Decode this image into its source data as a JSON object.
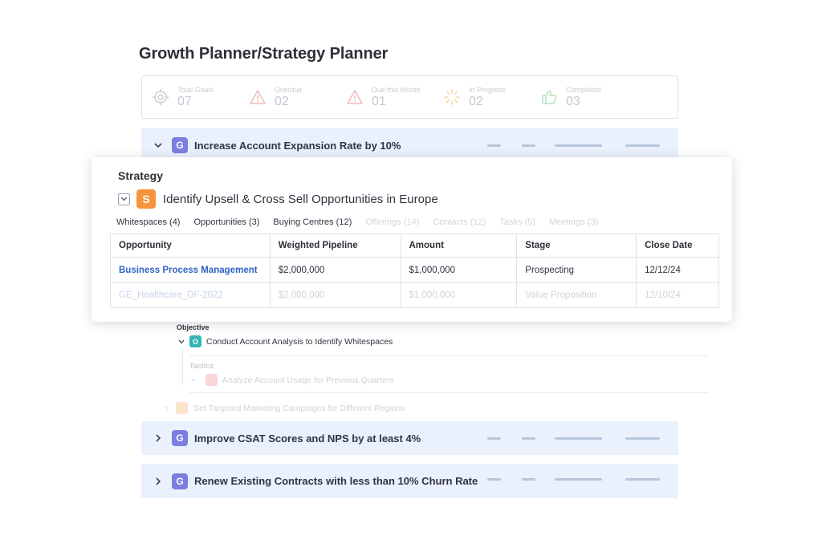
{
  "page": {
    "title": "Growth Planner/Strategy Planner"
  },
  "stats": [
    {
      "label": "Total Goals",
      "value": "07",
      "icon": "target-icon"
    },
    {
      "label": "Overdue",
      "value": "02",
      "icon": "warning-icon"
    },
    {
      "label": "Due this Month",
      "value": "01",
      "icon": "warning-icon"
    },
    {
      "label": "In Progress",
      "value": "02",
      "icon": "spinner-icon"
    },
    {
      "label": "Completed",
      "value": "03",
      "icon": "thumbs-up-icon"
    }
  ],
  "goals": [
    {
      "badge": "G",
      "title": "Increase Account Expansion Rate by 10%",
      "expanded": true
    },
    {
      "badge": "G",
      "title": "Improve CSAT Scores and NPS by at least 4%",
      "expanded": false
    },
    {
      "badge": "G",
      "title": "Renew Existing Contracts with less than 10% Churn Rate",
      "expanded": false
    }
  ],
  "strategy": {
    "heading": "Strategy",
    "badge": "S",
    "title": "Identify Upsell & Cross Sell Opportunities in Europe",
    "tabs": [
      {
        "label": "Whitespaces (4)",
        "active": true
      },
      {
        "label": "Opportunities (3)",
        "active": true
      },
      {
        "label": "Buying Centres (12)",
        "active": true
      },
      {
        "label": "Offerings (14)",
        "active": false
      },
      {
        "label": "Contacts (12)",
        "active": false
      },
      {
        "label": "Tasks (5)",
        "active": false
      },
      {
        "label": "Meetings (3)",
        "active": false
      }
    ],
    "table": {
      "headers": [
        "Opportunity",
        "Weighted Pipeline",
        "Amount",
        "Stage",
        "Close Date"
      ],
      "rows": [
        [
          "Business Process Management",
          "$2,000,000",
          "$1,000,000",
          "Prospecting",
          "12/12/24"
        ],
        [
          "GE_Healthcare_DF-2022",
          "$2,000,000",
          "$1,000,000",
          "Value Proposition",
          "12/10/24"
        ]
      ]
    }
  },
  "objective": {
    "label": "Objective",
    "badge": "O",
    "title": "Conduct Account Analysis to Identify Whitespaces",
    "tactics_label": "Tactics",
    "tactic": "Analyze Account Usage for Previous Quarters",
    "next_objective": "Set Targeted Marketing Campaigns for Different Regions"
  },
  "colors": {
    "goal_badge": "#7b7fe0",
    "strategy_badge": "#f7933a",
    "objective_badge": "#33b5b5",
    "link": "#2f62c4",
    "row_bg": "#eaf1fc"
  }
}
